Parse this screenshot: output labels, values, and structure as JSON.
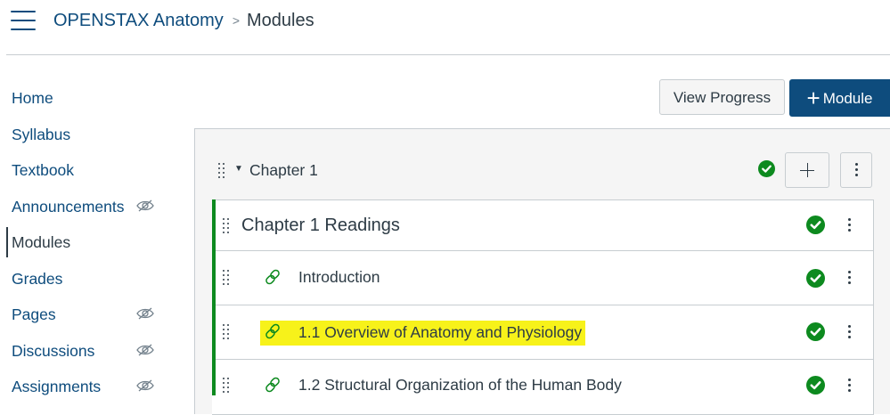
{
  "header": {
    "breadcrumb": {
      "course": "OPENSTAX Anatomy",
      "separator": ">",
      "current": "Modules"
    }
  },
  "sidebar": {
    "items": [
      {
        "label": "Home",
        "hidden_icon": false
      },
      {
        "label": "Syllabus",
        "hidden_icon": false
      },
      {
        "label": "Textbook",
        "hidden_icon": false
      },
      {
        "label": "Announcements",
        "hidden_icon": true
      },
      {
        "label": "Modules",
        "hidden_icon": false,
        "active": true
      },
      {
        "label": "Grades",
        "hidden_icon": false
      },
      {
        "label": "Pages",
        "hidden_icon": true
      },
      {
        "label": "Discussions",
        "hidden_icon": true
      },
      {
        "label": "Assignments",
        "hidden_icon": true
      }
    ]
  },
  "toolbar": {
    "view_progress_label": "View Progress",
    "add_module_label": "Module"
  },
  "module": {
    "title": "Chapter 1",
    "items": [
      {
        "title": "Chapter 1 Readings",
        "type": "subheader",
        "completed": true
      },
      {
        "title": "Introduction",
        "type": "link",
        "completed": true
      },
      {
        "title": "1.1 Overview of Anatomy and Physiology",
        "type": "link",
        "completed": true,
        "highlighted": true
      },
      {
        "title": "1.2 Structural Organization of the Human Body",
        "type": "link",
        "completed": true
      }
    ]
  },
  "colors": {
    "brand": "#0e4c7d",
    "success": "#0d8a1f",
    "highlight": "#f7f21a",
    "text": "#2d3b45",
    "border": "#c7cdd1"
  },
  "icons": {
    "menu": "hamburger-icon",
    "hidden": "eye-slash-icon",
    "drag": "drag-handle-icon",
    "collapse": "caret-down-icon",
    "complete": "check-circle-icon",
    "add": "plus-icon",
    "more": "kebab-icon",
    "link": "link-icon"
  }
}
